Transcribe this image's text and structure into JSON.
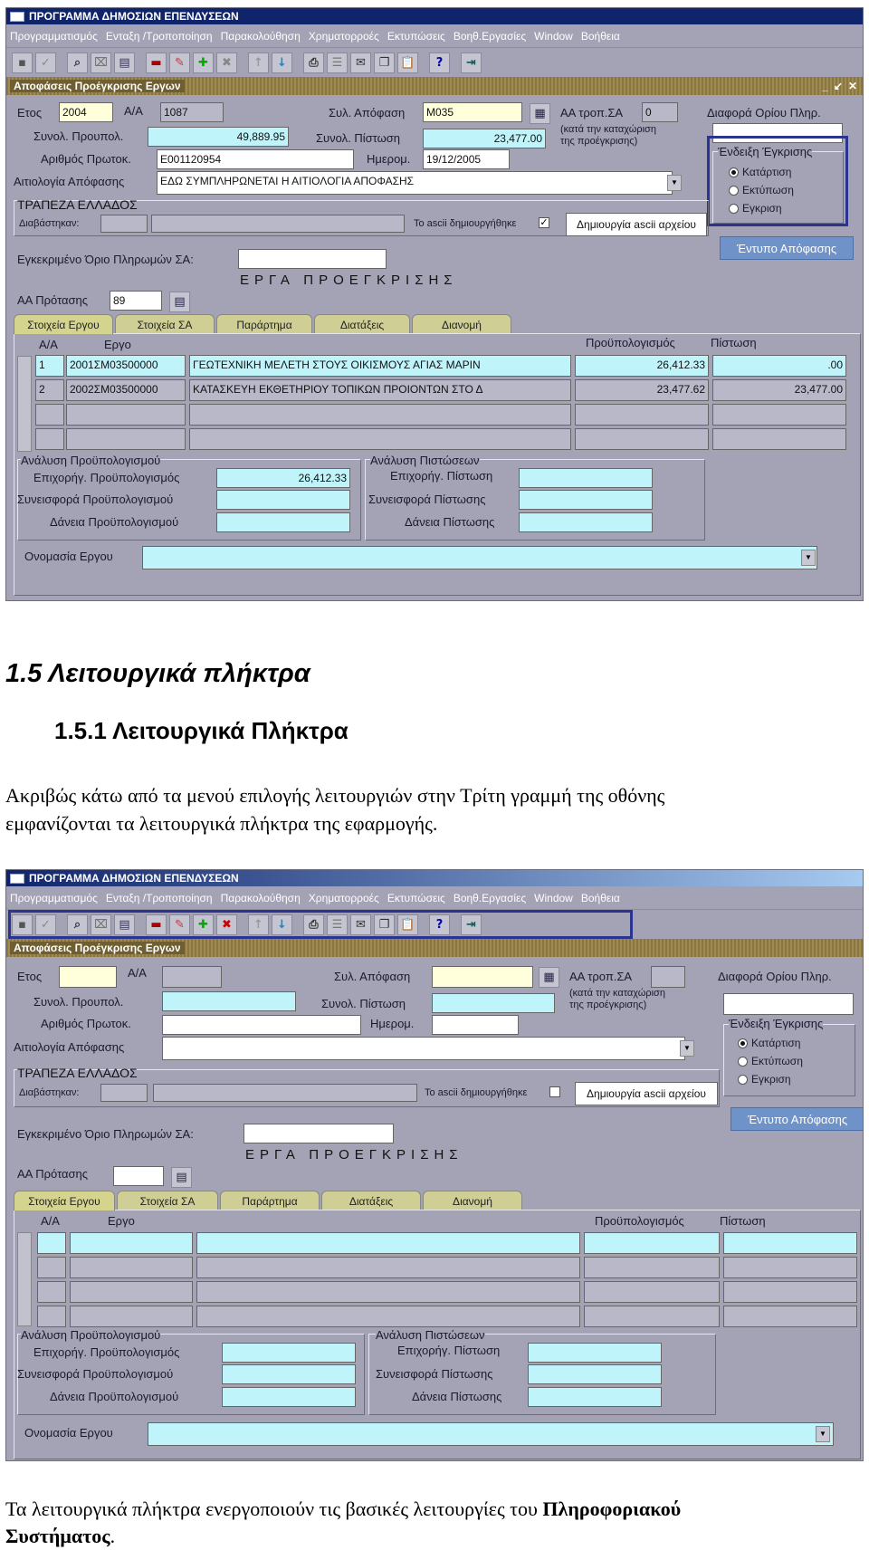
{
  "app_title": "ΠΡΟΓΡΑΜΜΑ ΔΗΜΟΣΙΩΝ ΕΠΕΝΔΥΣΕΩΝ",
  "menu": [
    "Προγραμματισμός",
    "Ενταξη /Τροποποίηση",
    "Παρακολούθηση",
    "Χρηματορροές",
    "Εκτυπώσεις",
    "Βοηθ.Εργασίες",
    "Window",
    "Βοήθεια"
  ],
  "window_title": "Αποφάσεις Προέγκρισης Εργων",
  "labels": {
    "etos": "Ετος",
    "aa": "Α/Α",
    "syl_apofasi": "Συλ. Απόφαση",
    "aa_trop_sa": "ΑΑ τροπ.ΣΑ",
    "kata_tin": "(κατά την καταχώριση",
    "tis_proegkrisis": "της προέγκρισης)",
    "diafora_oriou": "Διαφορά Ορίου Πληρ.",
    "synol_proypol": "Συνολ. Προυπολ.",
    "synol_pistosi": "Συνολ. Πίστωση",
    "arithmos_protok": "Αριθμός Πρωτοκ.",
    "imerom": "Ημερομ.",
    "aitiologia": "Αιτιολογία Απόφασης",
    "endeixi": "Ένδειξη Έγκρισης",
    "trapeza": "ΤΡΑΠΕΖΑ ΕΛΛΑΔΟΣ",
    "diavastikan": "Διαβάστηκαν:",
    "ascii_created": "Το ascii δημιουργήθηκε",
    "create_ascii": "Δημιουργία ascii αρχείου",
    "entypo": "Έντυπο Απόφασης",
    "egkekrimeno_orio": "Εγκεκριμένο Όριο Πληρωμών ΣΑ:",
    "erga_header": "ΕΡΓΑ ΠΡΟΕΓΚΡΙΣΗΣ",
    "aa_protasis": "ΑΑ Πρότασης",
    "col_aa": "Α/Α",
    "col_ergo": "Εργο",
    "col_proypol": "Προϋπολογισμός",
    "col_pistosi": "Πίστωση",
    "analysi_proypol": "Ανάλυση Προϋπολογισμού",
    "epixorig_proypol": "Επιχορήγ. Προϋπολογισμός",
    "synisfora_proypol": "Συνεισφορά Προϋπολογισμού",
    "daneia_proypol": "Δάνεια Προϋπολογισμού",
    "analysi_pistoseon": "Ανάλυση Πιστώσεων",
    "epixorig_pistosi": "Επιχορήγ. Πίστωση",
    "synisfora_pistosis": "Συνεισφορά Πίστωσης",
    "daneia_pistosis": "Δάνεια Πίστωσης",
    "onomasia": "Ονομασία Εργου"
  },
  "radios": [
    "Κατάρτιση",
    "Εκτύπωση",
    "Εγκριση"
  ],
  "tabs": [
    "Στοιχεία Εργου",
    "Στοιχεία ΣΑ",
    "Παράρτημα",
    "Διατάξεις",
    "Διανομή"
  ],
  "shot1": {
    "etos": "2004",
    "aa": "1087",
    "syl_apofasi": "Μ035",
    "aa_trop": "0",
    "synol_proypol": "49,889.95",
    "synol_pistosi": "23,477.00",
    "arithmos_protok": "Ε001120954",
    "imerom": "19/12/2005",
    "aitiologia": "ΕΔΩ ΣΥΜΠΛΗΡΩΝΕΤΑΙ Η ΑΙΤΙΟΛΟΓΙΑ ΑΠΟΦΑΣΗΣ",
    "aa_protasis": "89",
    "ascii_checked": "✓",
    "rows": [
      {
        "aa": "1",
        "code": "2001ΣΜ03500000",
        "ergo": "ΓΕΩΤΕΧΝΙΚΗ ΜΕΛΕΤΗ ΣΤΟΥΣ ΟΙΚΙΣΜΟΥΣ ΑΓΙΑΣ ΜΑΡΙΝ",
        "proypol": "26,412.33",
        "pistosi": ".00"
      },
      {
        "aa": "2",
        "code": "2002ΣΜ03500000",
        "ergo": "ΚΑΤΑΣΚΕΥΗ ΕΚΘΕΤΗΡΙΟΥ ΤΟΠΙΚΩΝ ΠΡΟΙΟΝΤΩΝ ΣΤΟ Δ",
        "proypol": "23,477.62",
        "pistosi": "23,477.00"
      }
    ],
    "epixorig_proypol": "26,412.33"
  },
  "doc": {
    "heading1": "1.5 Λειτουργικά πλήκτρα",
    "heading2": "1.5.1  Λειτουργικά Πλήκτρα",
    "para1_line1": "Ακριβώς κάτω από τα μενού επιλογής λειτουργιών στην Τρίτη γραμμή της οθόνης",
    "para1_line2": "εμφανίζονται τα λειτουργικά πλήκτρα της εφαρμογής.",
    "para2_start": "Τα λειτουργικά πλήκτρα ενεργοποιούν τις βασικές λειτουργίες του ",
    "para2_bold1": "Πληροφοριακού",
    "para2_bold2": "Συστήματος",
    "para2_end": "."
  },
  "icons": [
    "save-icon",
    "check-icon",
    "query-icon",
    "clear-icon",
    "print-preview-icon",
    "delete-block-icon",
    "edit-icon",
    "insert-record-icon",
    "delete-record-icon",
    "up-icon",
    "down-icon",
    "print-icon",
    "list-icon",
    "report-icon",
    "copy-icon",
    "paste-icon",
    "help-icon",
    "exit-icon"
  ]
}
